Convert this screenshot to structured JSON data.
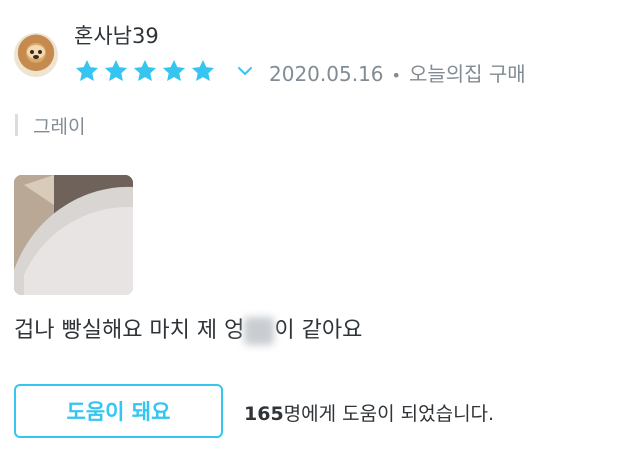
{
  "review": {
    "username": "혼사남39",
    "rating": 5,
    "date": "2020.05.16",
    "source": "오늘의집 구매",
    "option": "그레이",
    "content_before": "겁나 빵실해요 마치 제 엉",
    "content_after": "이 같아요"
  },
  "help": {
    "button_label": "도움이 돼요",
    "count": "165",
    "suffix": "명에게 도움이 되었습니다."
  },
  "colors": {
    "accent": "#35c5f0",
    "text": "#2f3438",
    "muted": "#828c94"
  },
  "icons": {
    "avatar": "dog-avatar",
    "star": "star-icon",
    "expand": "chevron-down-icon"
  }
}
